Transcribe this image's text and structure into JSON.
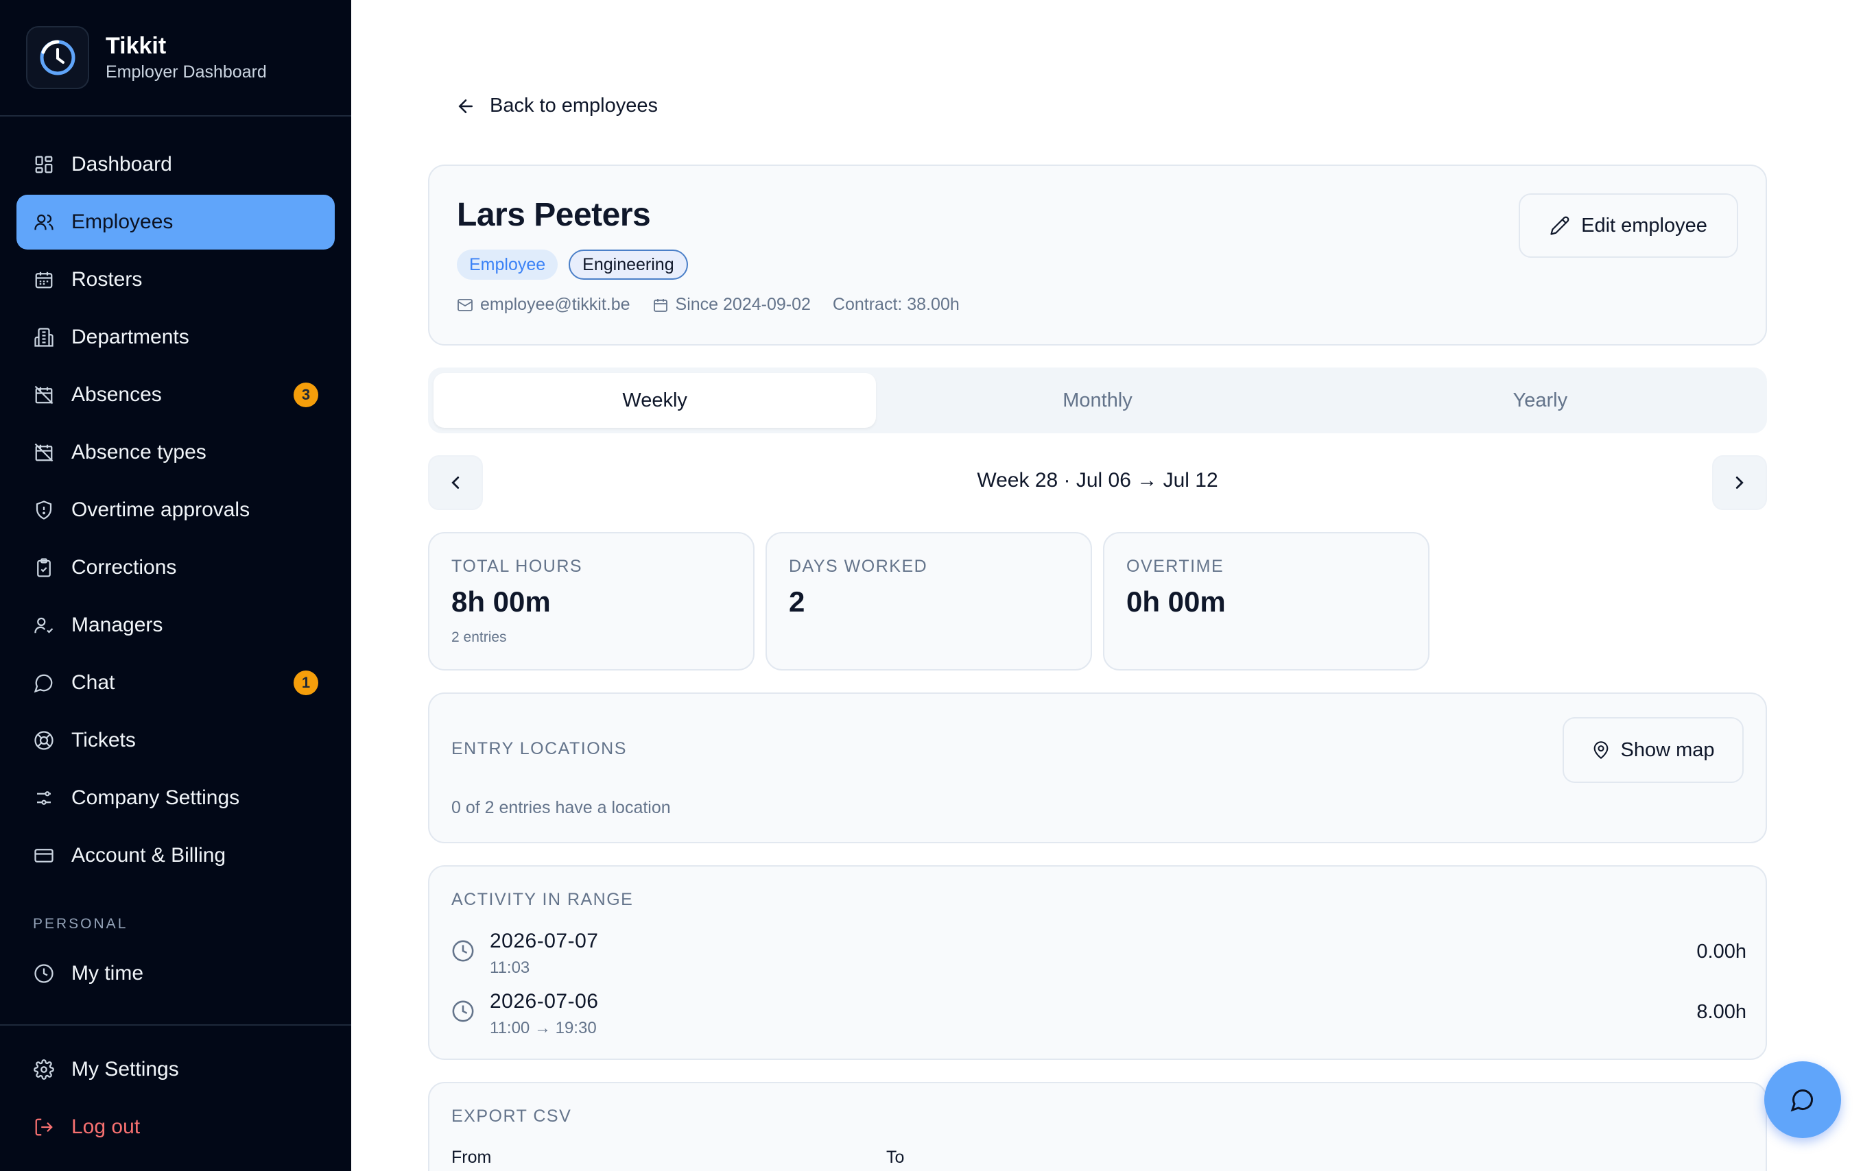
{
  "brand": {
    "name": "Tikkit",
    "subtitle": "Employer Dashboard"
  },
  "sidebar": {
    "items": [
      {
        "label": "Dashboard",
        "icon": "dashboard-icon"
      },
      {
        "label": "Employees",
        "icon": "users-icon",
        "active": true
      },
      {
        "label": "Rosters",
        "icon": "calendar-icon"
      },
      {
        "label": "Departments",
        "icon": "building-icon"
      },
      {
        "label": "Absences",
        "icon": "calendar-off-icon",
        "badge": "3"
      },
      {
        "label": "Absence types",
        "icon": "calendar-off-icon"
      },
      {
        "label": "Overtime approvals",
        "icon": "shield-icon"
      },
      {
        "label": "Corrections",
        "icon": "clipboard-icon"
      },
      {
        "label": "Managers",
        "icon": "user-check-icon"
      },
      {
        "label": "Chat",
        "icon": "message-icon",
        "badge": "1"
      },
      {
        "label": "Tickets",
        "icon": "lifebuoy-icon"
      },
      {
        "label": "Company Settings",
        "icon": "sliders-icon"
      },
      {
        "label": "Account & Billing",
        "icon": "credit-card-icon"
      }
    ],
    "personal_label": "PERSONAL",
    "personal_items": [
      {
        "label": "My time",
        "icon": "clock-icon"
      }
    ],
    "bottom_items": [
      {
        "label": "My Settings",
        "icon": "gear-icon"
      },
      {
        "label": "Log out",
        "icon": "logout-icon"
      }
    ]
  },
  "main": {
    "back_label": "Back to employees",
    "employee": {
      "name": "Lars Peeters",
      "role": "Employee",
      "department": "Engineering",
      "email": "employee@tikkit.be",
      "since": "Since 2024-09-02",
      "contract": "Contract: 38.00h"
    },
    "edit_label": "Edit employee",
    "tabs": [
      {
        "label": "Weekly",
        "active": true
      },
      {
        "label": "Monthly"
      },
      {
        "label": "Yearly"
      }
    ],
    "week_label": "Week 28 · Jul 06 → Jul 12",
    "stats": [
      {
        "label": "TOTAL HOURS",
        "value": "8h 00m",
        "sub": "2 entries"
      },
      {
        "label": "DAYS WORKED",
        "value": "2"
      },
      {
        "label": "OVERTIME",
        "value": "0h 00m"
      }
    ],
    "locations": {
      "title": "ENTRY LOCATIONS",
      "subtitle": "0 of 2 entries have a location",
      "button": "Show map"
    },
    "activity": {
      "title": "ACTIVITY IN RANGE",
      "rows": [
        {
          "date": "2026-07-07",
          "time": "11:03",
          "hours": "0.00h"
        },
        {
          "date": "2026-07-06",
          "time": "11:00 → 19:30",
          "hours": "8.00h"
        }
      ]
    },
    "export": {
      "title": "EXPORT CSV",
      "from_label": "From",
      "to_label": "To"
    }
  },
  "colors": {
    "sidebar_bg": "#020817",
    "accent": "#60a5fa",
    "badge": "#f59e0b",
    "logout": "#f87171"
  }
}
